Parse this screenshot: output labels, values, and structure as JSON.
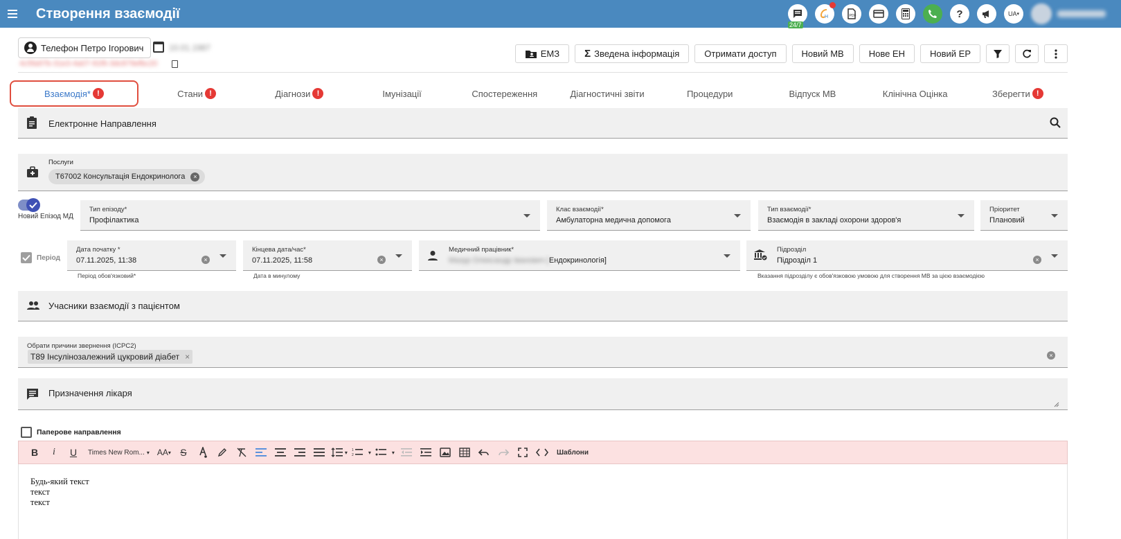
{
  "header": {
    "title": "Створення взаємодії",
    "badge_247": "24/7",
    "lang": "UA",
    "icons": [
      "chat-icon",
      "chatbot-icon",
      "pdf-icon",
      "card-icon",
      "calculator-icon",
      "phone-icon",
      "help-icon",
      "megaphone-icon",
      "lang-icon"
    ]
  },
  "patient": {
    "name": "Телефон Петро Ігорович",
    "birth_date_blurred": "10.01.1987",
    "id_blurred": "4c5fa97b-31e3-4a07-91f6-3dc879efbc20"
  },
  "actions": {
    "emz": "ЕМЗ",
    "summary": "Зведена інформація",
    "get_access": "Отримати доступ",
    "new_mv": "Новий МВ",
    "new_en": "Нове ЕН",
    "new_er": "Новий ЕР"
  },
  "tabs": [
    {
      "label": "Взаємодія*",
      "error": "!"
    },
    {
      "label": "Стани",
      "error": "!"
    },
    {
      "label": "Діагнози",
      "error": "!"
    },
    {
      "label": "Імунізації"
    },
    {
      "label": "Спостереження"
    },
    {
      "label": "Діагностичні звіти"
    },
    {
      "label": "Процедури"
    },
    {
      "label": "Відпуск МВ"
    },
    {
      "label": "Клінічна Оцінка"
    },
    {
      "label": "Зберегти",
      "error": "!"
    }
  ],
  "referral": {
    "title": "Електронне Направлення"
  },
  "services": {
    "label": "Послуги",
    "chip": "T67002 Консультація Ендокринолога"
  },
  "episode": {
    "toggle_label": "Новий Епізод МД",
    "type_label": "Тип епізоду*",
    "type_value": "Профілактика"
  },
  "encounter_class": {
    "label": "Клас взаємодії*",
    "value": "Амбулаторна медична допомога"
  },
  "encounter_type": {
    "label": "Тип взаємодії*",
    "value": "Взаємодія в закладі охорони здоров'я"
  },
  "priority": {
    "label": "Пріоритет",
    "value": "Плановий"
  },
  "period": {
    "checkbox_label": "Період",
    "start_label": "Дата початку *",
    "start_value": "07.11.2025, 11:38",
    "start_hint": "Період обов'язковий*",
    "end_label": "Кінцева дата/час*",
    "end_value": "07.11.2025, 11:58",
    "end_hint": "Дата в минулому"
  },
  "practitioner": {
    "label": "Медичний працівник*",
    "value_blurred": "Мазур Олександр Іванович [",
    "value_visible": "Ендокринологія]"
  },
  "division": {
    "label": "Підрозділ",
    "value": "Підрозділ 1",
    "hint": "Вказання підрозділу є обов'язковою умовою для створення МВ за цією взаємодією"
  },
  "participants": {
    "title": "Учасники взаємодії з пацієнтом"
  },
  "reasons": {
    "label": "Обрати причини звернення (ICPC2)",
    "chip": "T89 Інсулінозалежний цукровий діабет"
  },
  "prescription": {
    "title": "Призначення лікаря"
  },
  "paper_referral": {
    "label": "Паперове направлення"
  },
  "toolbar": {
    "bold": "B",
    "italic": "i",
    "underline": "U",
    "font": "Times New Rom...",
    "font_size": "AA",
    "templates": "Шаблони"
  },
  "editor": {
    "lines": [
      "Будь-який текст",
      "текст",
      "текст"
    ]
  }
}
